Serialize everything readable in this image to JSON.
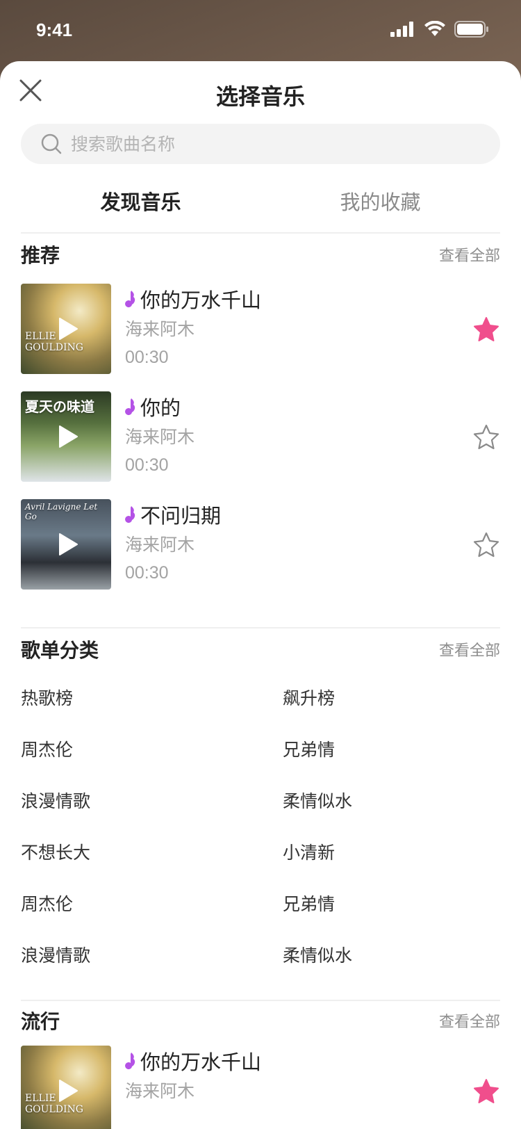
{
  "status": {
    "time": "9:41"
  },
  "header": {
    "title": "选择音乐"
  },
  "search": {
    "placeholder": "搜索歌曲名称"
  },
  "tabs": [
    {
      "label": "发现音乐",
      "active": true
    },
    {
      "label": "我的收藏",
      "active": false
    }
  ],
  "recommend": {
    "title": "推荐",
    "see_all": "查看全部",
    "songs": [
      {
        "title": "你的万水千山",
        "artist": "海来阿木",
        "duration": "00:30",
        "favorited": true,
        "cover_text": "ELLIE GOULDING"
      },
      {
        "title": "你的",
        "artist": "海来阿木",
        "duration": "00:30",
        "favorited": false,
        "cover_text": "夏天の味道"
      },
      {
        "title": "不问归期",
        "artist": "海来阿木",
        "duration": "00:30",
        "favorited": false,
        "cover_text": "Avril Lavigne  Let Go"
      }
    ]
  },
  "playlists": {
    "title": "歌单分类",
    "see_all": "查看全部",
    "items": [
      "热歌榜",
      "飙升榜",
      "周杰伦",
      "兄弟情",
      "浪漫情歌",
      "柔情似水",
      "不想长大",
      "小清新",
      "周杰伦",
      "兄弟情",
      "浪漫情歌",
      "柔情似水"
    ]
  },
  "popular": {
    "title": "流行",
    "see_all": "查看全部",
    "songs": [
      {
        "title": "你的万水千山",
        "artist": "海来阿木",
        "favorited": true,
        "cover_text": "ELLIE GOULDING"
      }
    ]
  },
  "colors": {
    "accent_pink": "#f04e8c",
    "note_purple": "#b452e6",
    "star_outline": "#8a8a8a"
  }
}
